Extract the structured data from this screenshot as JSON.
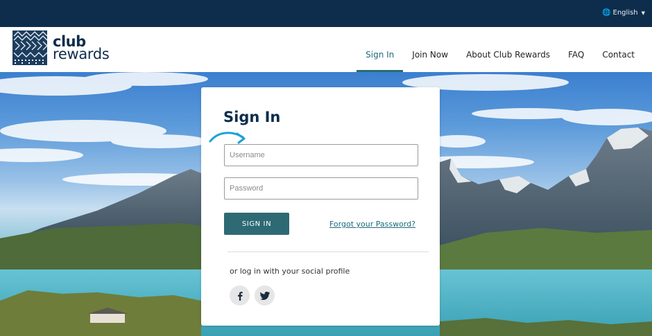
{
  "topbar": {
    "language": "English",
    "globe_icon": "globe-icon",
    "caret_icon": "caret-down-icon"
  },
  "logo": {
    "line1": "club",
    "line2": "rewards"
  },
  "nav": {
    "items": [
      {
        "label": "Sign In",
        "active": true
      },
      {
        "label": "Join Now",
        "active": false
      },
      {
        "label": "About Club Rewards",
        "active": false
      },
      {
        "label": "FAQ",
        "active": false
      },
      {
        "label": "Contact",
        "active": false
      }
    ]
  },
  "login": {
    "title": "Sign In",
    "username_placeholder": "Username",
    "username_value": "",
    "password_placeholder": "Password",
    "password_value": "",
    "submit_label": "SIGN IN",
    "forgot_label": "Forgot your Password?",
    "social_label": "or log in with your social profile",
    "social": [
      {
        "icon": "facebook-icon",
        "glyph": "f"
      },
      {
        "icon": "twitter-icon",
        "glyph": "t"
      }
    ]
  },
  "colors": {
    "topbar": "#0e2d4c",
    "brand_navy": "#0e2d4c",
    "accent_teal": "#2e6a74",
    "link": "#1d6a7c",
    "arrow": "#1ea0d6"
  }
}
